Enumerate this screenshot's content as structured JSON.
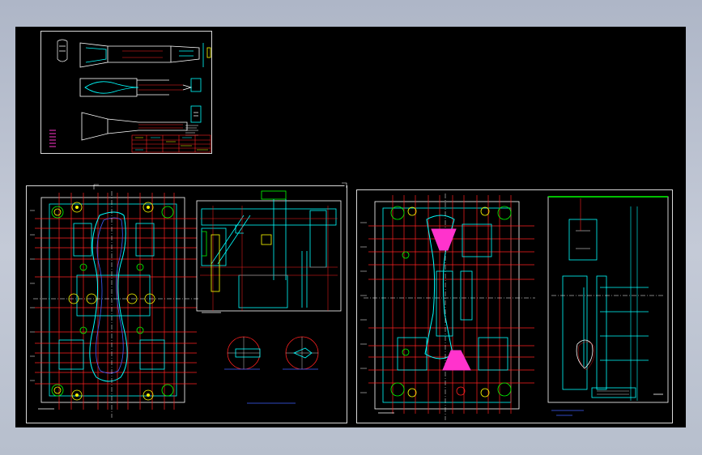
{
  "sheets": [
    {
      "id": "part-drawing",
      "kind": "part drawing",
      "title_block": true
    },
    {
      "id": "fixed-mold-plate",
      "kind": "mold assembly (fixed half)",
      "title_block": false
    },
    {
      "id": "moving-mold-plate",
      "kind": "mold assembly (moving half)",
      "title_block": false
    }
  ],
  "colors": {
    "background": "#000000",
    "border": "#d8d8d8",
    "cyan": "#00ffff",
    "red": "#ff2020",
    "yellow": "#ffff00",
    "white": "#ffffff",
    "green": "#00ff00",
    "magenta": "#ff33cc",
    "blue": "#4060ff"
  }
}
